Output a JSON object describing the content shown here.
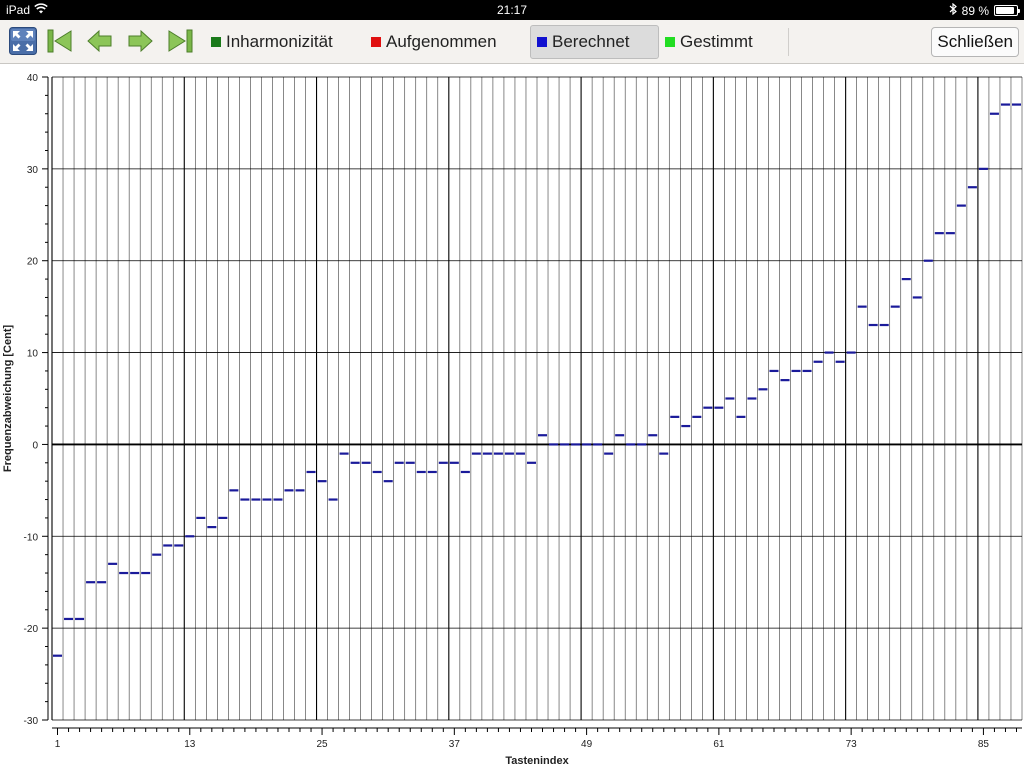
{
  "statusbar": {
    "device": "iPad",
    "time": "21:17",
    "battery": "89 %",
    "battery_level": 0.89
  },
  "toolbar": {
    "legend": [
      {
        "label": "Inharmonizität",
        "color": "#1a7a1a",
        "active": false
      },
      {
        "label": "Aufgenommen",
        "color": "#e01010",
        "active": false
      },
      {
        "label": "Berechnet",
        "color": "#1010d0",
        "active": true
      },
      {
        "label": "Gestimmt",
        "color": "#22dd22",
        "active": false
      }
    ],
    "close_label": "Schließen",
    "icons": [
      "fullscreen-icon",
      "first-icon",
      "previous-icon",
      "next-icon",
      "last-icon"
    ]
  },
  "chart_data": {
    "type": "step",
    "xlabel": "Tastenindex",
    "ylabel": "Frequenzabweichung [Cent]",
    "xlim": [
      0.5,
      88.5
    ],
    "ylim": [
      -30,
      40
    ],
    "yticks": [
      -30,
      -20,
      -10,
      0,
      10,
      20,
      30,
      40
    ],
    "xticks": [
      1,
      13,
      25,
      37,
      49,
      61,
      73,
      85
    ],
    "grid": true,
    "series": [
      {
        "color": "#1a1a9a",
        "keys": [
          1,
          2,
          3,
          4,
          5,
          6,
          7,
          8,
          9,
          10,
          11,
          12,
          13,
          14,
          15,
          16,
          17,
          18,
          19,
          20,
          21,
          22,
          23,
          24,
          25,
          26,
          27,
          28,
          29,
          30,
          31,
          32,
          33,
          34,
          35,
          36,
          37,
          38,
          39,
          40,
          41,
          42,
          43,
          44,
          45,
          46,
          47,
          48,
          49,
          50,
          51,
          52,
          53,
          54,
          55,
          56,
          57,
          58,
          59,
          60,
          61,
          62,
          63,
          64,
          65,
          66,
          67,
          68,
          69,
          70,
          71,
          72,
          73,
          74,
          75,
          76,
          77,
          78,
          79,
          80,
          81,
          82,
          83,
          84,
          85,
          86,
          87,
          88
        ],
        "values": [
          -23,
          -19,
          -19,
          -15,
          -15,
          -13,
          -14,
          -14,
          -14,
          -12,
          -11,
          -11,
          -10,
          -8,
          -9,
          -8,
          -5,
          -6,
          -6,
          -6,
          -6,
          -5,
          -5,
          -3,
          -4,
          -6,
          -1,
          -2,
          -2,
          -3,
          -4,
          -2,
          -2,
          -3,
          -3,
          -2,
          -2,
          -3,
          -1,
          -1,
          -1,
          -1,
          -1,
          -2,
          1,
          0,
          0,
          0,
          0,
          0,
          -1,
          1,
          0,
          0,
          1,
          -1,
          3,
          2,
          3,
          4,
          4,
          5,
          3,
          5,
          6,
          8,
          7,
          8,
          8,
          9,
          10,
          9,
          10,
          15,
          13,
          13,
          15,
          18,
          16,
          20,
          23,
          23,
          26,
          28,
          30,
          36,
          37,
          37
        ]
      }
    ]
  }
}
